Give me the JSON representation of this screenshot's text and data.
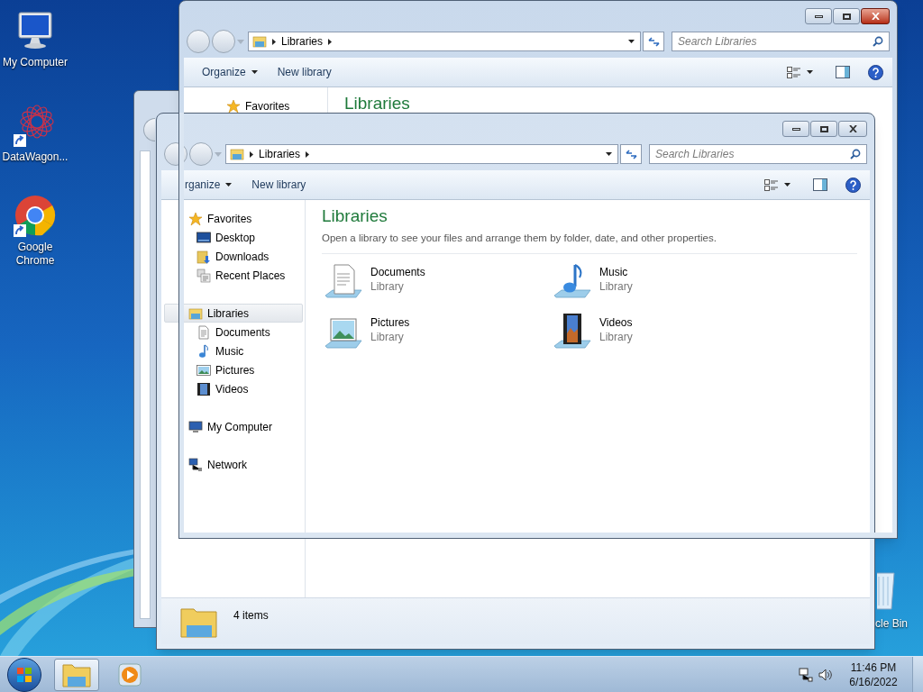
{
  "desktop_icons": [
    {
      "label": "My Computer",
      "kind": "computer",
      "shortcut": false
    },
    {
      "label": "DataWagon...",
      "kind": "web",
      "shortcut": true
    },
    {
      "label": "Google Chrome",
      "kind": "chrome",
      "shortcut": true
    }
  ],
  "recycle_bin": {
    "label": "cle Bin"
  },
  "top_window": {
    "close_hovered": true,
    "address": "Libraries",
    "search_placeholder": "Search Libraries",
    "toolbar": [
      {
        "label": "Organize",
        "kind": "menu"
      },
      {
        "label": "New library",
        "kind": "button"
      }
    ],
    "sidebar": [
      {
        "label": "Favorites",
        "kind": "star",
        "selected": false
      }
    ],
    "heading": "Libraries"
  },
  "front_window": {
    "close_hovered": false,
    "address": "Libraries",
    "search_placeholder": "Search Libraries",
    "toolbar": [
      {
        "label": "rganize",
        "kind": "menu"
      },
      {
        "label": "New library",
        "kind": "button"
      }
    ],
    "sidebar": [
      {
        "label": "Favorites",
        "kind": "star",
        "selected": false,
        "children": [
          {
            "label": "Desktop",
            "kind": "desktop",
            "selected": false
          },
          {
            "label": "Downloads",
            "kind": "downloads",
            "selected": false
          },
          {
            "label": "Recent Places",
            "kind": "recent",
            "selected": false
          }
        ]
      },
      {
        "label": "Libraries",
        "kind": "library",
        "selected": true,
        "children": [
          {
            "label": "Documents",
            "kind": "document",
            "selected": false
          },
          {
            "label": "Music",
            "kind": "music",
            "selected": false
          },
          {
            "label": "Pictures",
            "kind": "picture",
            "selected": false
          },
          {
            "label": "Videos",
            "kind": "video",
            "selected": false
          }
        ]
      },
      {
        "label": "My Computer",
        "kind": "computer",
        "selected": false
      },
      {
        "label": "Network",
        "kind": "network",
        "selected": false
      }
    ],
    "heading": "Libraries",
    "description": "Open a library to see your files and arrange them by folder, date, and other properties.",
    "items": [
      {
        "name": "Documents",
        "type": "Library",
        "kind": "document"
      },
      {
        "name": "Music",
        "type": "Library",
        "kind": "music"
      },
      {
        "name": "Pictures",
        "type": "Library",
        "kind": "picture"
      },
      {
        "name": "Videos",
        "type": "Library",
        "kind": "video"
      }
    ],
    "status": "4 items"
  },
  "taskbar": {
    "buttons": [
      {
        "kind": "explorer",
        "selected": true
      },
      {
        "kind": "media",
        "selected": false
      }
    ],
    "time": "11:46 PM",
    "date": "6/16/2022"
  }
}
